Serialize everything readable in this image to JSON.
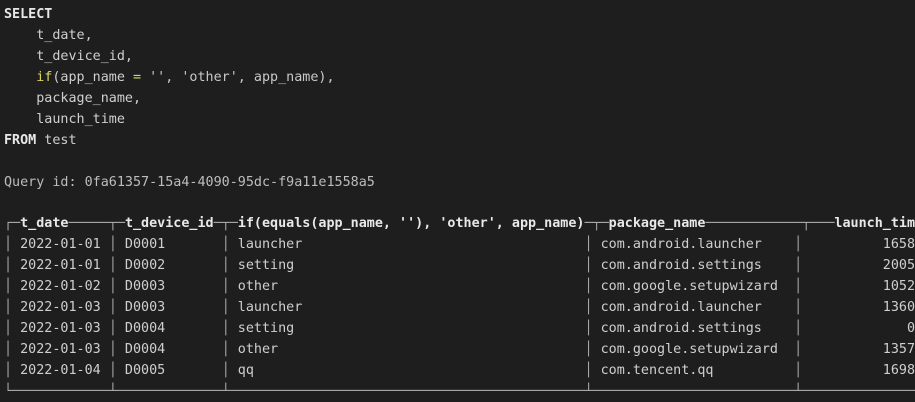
{
  "query": {
    "line1": "SELECT",
    "line2": "    t_date,",
    "line3": "    t_device_id,",
    "line4_fn": "if",
    "line4_rest1": "(app_name ",
    "line4_op": "=",
    "line4_rest2": " '', 'other', app_name),",
    "line4_indent": "    ",
    "line5": "    package_name,",
    "line6": "    launch_time",
    "line7_kw": "FROM",
    "line7_rest": " test"
  },
  "query_id_text": "Query id: 0fa61357-15a4-4090-95dc-f9a11e1558a5",
  "table": {
    "columns": [
      "t_date",
      "t_device_id",
      "if(equals(app_name, ''), 'other', app_name)",
      "package_name",
      "launch_time"
    ],
    "rows": [
      [
        "2022-01-01",
        "D0001",
        "launcher",
        "com.android.launcher",
        "1658"
      ],
      [
        "2022-01-01",
        "D0002",
        "setting",
        "com.android.settings",
        "2005"
      ],
      [
        "2022-01-02",
        "D0003",
        "other",
        "com.google.setupwizard",
        "1052"
      ],
      [
        "2022-01-03",
        "D0003",
        "launcher",
        "com.android.launcher",
        "1360"
      ],
      [
        "2022-01-03",
        "D0004",
        "setting",
        "com.android.settings",
        "0"
      ],
      [
        "2022-01-03",
        "D0004",
        "other",
        "com.google.setupwizard",
        "1357"
      ],
      [
        "2022-01-04",
        "D0005",
        "qq",
        "com.tencent.qq",
        "1698"
      ]
    ]
  }
}
